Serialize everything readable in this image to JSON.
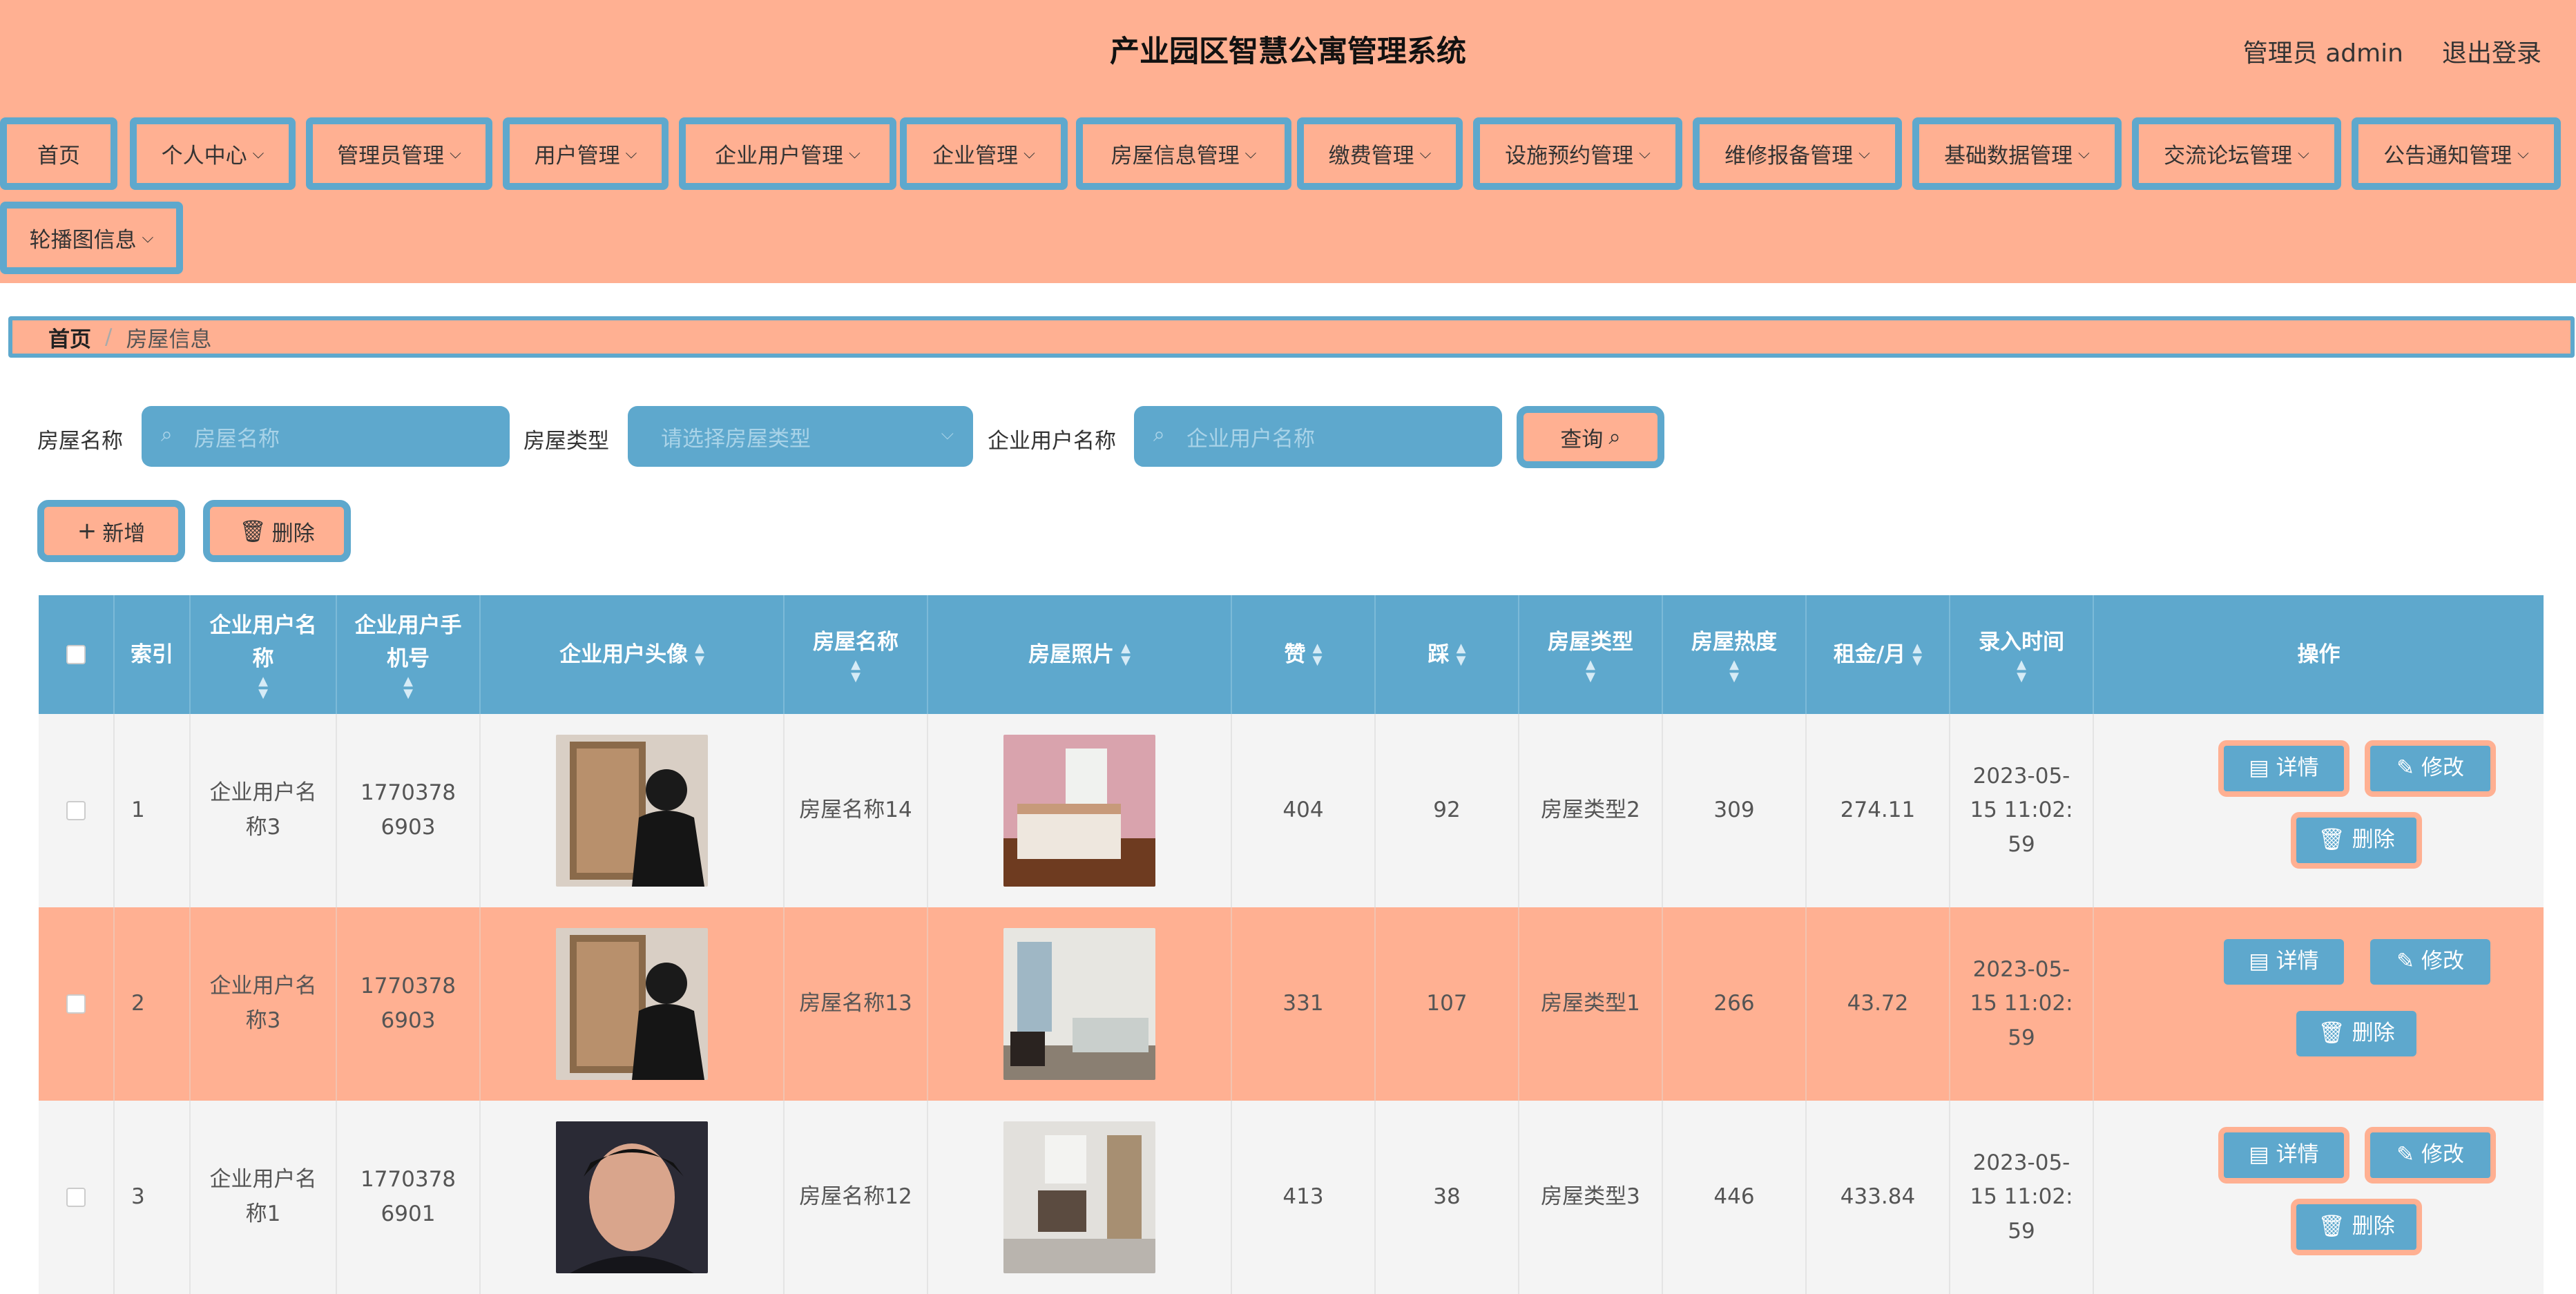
{
  "header": {
    "title": "产业园区智慧公寓管理系统",
    "user": "管理员 admin",
    "logout": "退出登录"
  },
  "nav": [
    "首页",
    "个人中心",
    "管理员管理",
    "用户管理",
    "企业用户管理",
    "企业管理",
    "房屋信息管理",
    "缴费管理",
    "设施预约管理",
    "维修报备管理",
    "基础数据管理",
    "交流论坛管理",
    "公告通知管理",
    "轮播图信息"
  ],
  "breadcrumb": {
    "home": "首页",
    "separator": "/",
    "current": "房屋信息"
  },
  "search": {
    "name_label": "房屋名称",
    "name_placeholder": "房屋名称",
    "type_label": "房屋类型",
    "type_placeholder": "请选择房屋类型",
    "user_label": "企业用户名称",
    "user_placeholder": "企业用户名称",
    "query": "查询"
  },
  "actions": {
    "add": "新增",
    "delete": "删除"
  },
  "table": {
    "headers": [
      "索引",
      "企业用户名称",
      "企业用户手机号",
      "企业用户头像",
      "房屋名称",
      "房屋照片",
      "赞",
      "踩",
      "房屋类型",
      "房屋热度",
      "租金/月",
      "录入时间",
      "操作"
    ],
    "rows": [
      {
        "index": "1",
        "user": "企业用户名称3",
        "phone": "17703786903",
        "house": "房屋名称14",
        "zan": "404",
        "cai": "92",
        "type": "房屋类型2",
        "heat": "309",
        "rent": "274.11",
        "time": "2023-05-15 11:02:59"
      },
      {
        "index": "2",
        "user": "企业用户名称3",
        "phone": "17703786903",
        "house": "房屋名称13",
        "zan": "331",
        "cai": "107",
        "type": "房屋类型1",
        "heat": "266",
        "rent": "43.72",
        "time": "2023-05-15 11:02:59"
      },
      {
        "index": "3",
        "user": "企业用户名称1",
        "phone": "17703786901",
        "house": "房屋名称12",
        "zan": "413",
        "cai": "38",
        "type": "房屋类型3",
        "heat": "446",
        "rent": "433.84",
        "time": "2023-05-15 11:02:59"
      }
    ],
    "ops": {
      "detail": "详情",
      "edit": "修改",
      "delete": "删除"
    }
  },
  "colors": {
    "peach": "#ffb092",
    "blue": "#5ea8cd"
  }
}
